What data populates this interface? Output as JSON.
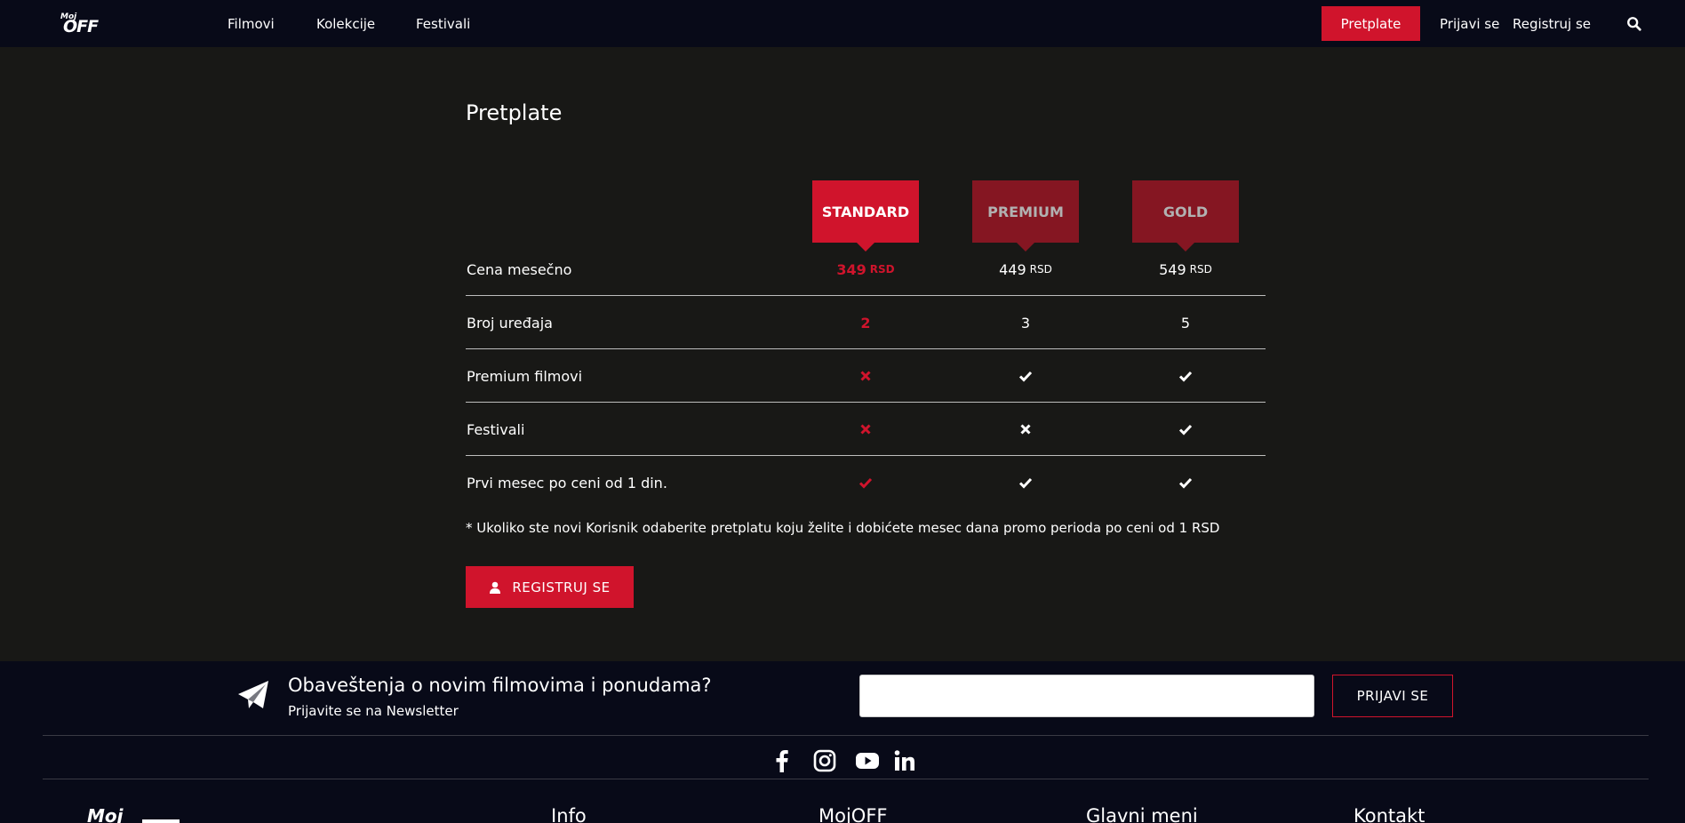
{
  "header": {
    "logo_top": "Moj",
    "logo_main": "OFF",
    "nav": [
      "Filmovi",
      "Kolekcije",
      "Festivali"
    ],
    "subscribe_button": "Pretplate",
    "login_link": "Prijavi se",
    "register_link": "Registruj se",
    "search_icon": "search-icon"
  },
  "main": {
    "title": "Pretplate",
    "plans": [
      {
        "name": "STANDARD",
        "selected": true
      },
      {
        "name": "PREMIUM",
        "selected": false
      },
      {
        "name": "GOLD",
        "selected": false
      }
    ],
    "rows": [
      {
        "label": "Cena mesečno",
        "values": [
          {
            "text": "349",
            "unit": "RSD"
          },
          {
            "text": "449",
            "unit": "RSD"
          },
          {
            "text": "549",
            "unit": "RSD"
          }
        ]
      },
      {
        "label": "Broj uređaja",
        "values": [
          {
            "text": "2"
          },
          {
            "text": "3"
          },
          {
            "text": "5"
          }
        ]
      },
      {
        "label": "Premium filmovi",
        "values": [
          {
            "icon": "times-icon"
          },
          {
            "icon": "check-icon"
          },
          {
            "icon": "check-icon"
          }
        ]
      },
      {
        "label": "Festivali",
        "values": [
          {
            "icon": "times-icon"
          },
          {
            "icon": "times-icon"
          },
          {
            "icon": "check-icon"
          }
        ]
      },
      {
        "label": "Prvi mesec po ceni od 1 din.",
        "values": [
          {
            "icon": "check-icon"
          },
          {
            "icon": "check-icon"
          },
          {
            "icon": "check-icon"
          }
        ]
      }
    ],
    "note": "* Ukoliko ste novi Korisnik odaberite pretplatu koju želite i dobićete mesec dana promo perioda po ceni od 1 RSD",
    "register_button": "REGISTRUJ SE",
    "colors": {
      "accent": "#d0142c",
      "plan_inactive": "#851622"
    }
  },
  "footer": {
    "newsletter_title": "Obaveštenja o novim filmovima i ponudama?",
    "newsletter_subtitle": "Prijavite se na Newsletter",
    "email_placeholder": "",
    "newsletter_button": "PRIJAVI SE",
    "social": [
      "facebook-icon",
      "instagram-icon",
      "youtube-icon",
      "linkedin-icon"
    ],
    "logo_top": "Moj",
    "columns": [
      "Info",
      "MojOFF",
      "Glavni meni",
      "Kontakt"
    ]
  }
}
